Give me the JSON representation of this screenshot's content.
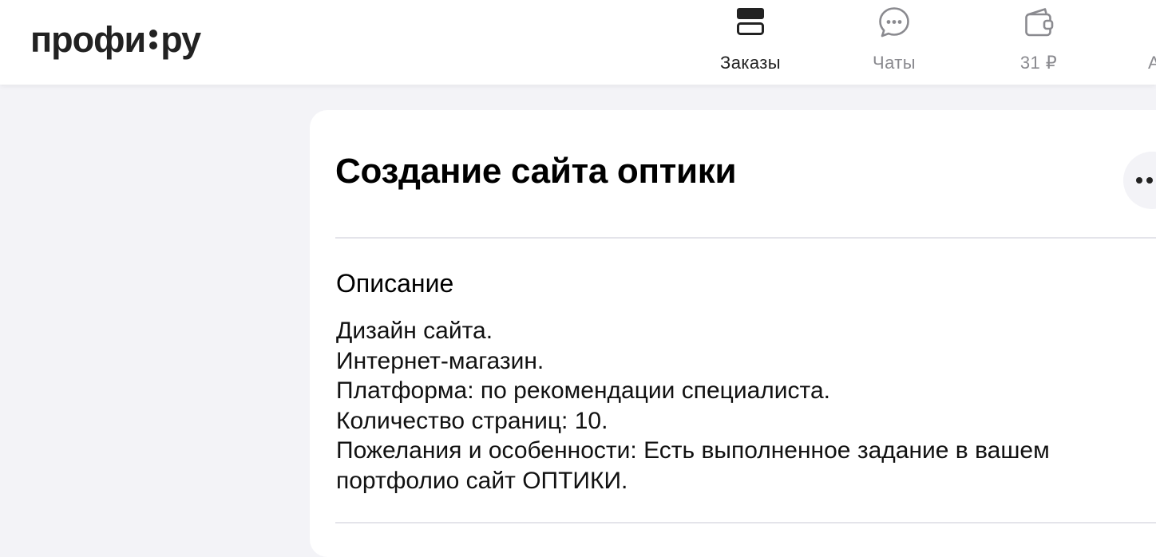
{
  "header": {
    "logo": {
      "left": "профи",
      "right": "ру"
    },
    "nav": [
      {
        "label": "Заказы",
        "icon": "orders-icon",
        "active": true
      },
      {
        "label": "Чаты",
        "icon": "chat-bubble-icon",
        "active": false
      },
      {
        "label": "31 ₽",
        "icon": "wallet-icon",
        "active": false
      }
    ],
    "nav_cut_label": "А"
  },
  "order": {
    "title": "Создание сайта оптики",
    "more_icon": "more-dots-icon",
    "description_heading": "Описание",
    "description_lines": [
      "Дизайн сайта.",
      "Интернет-магазин.",
      "Платформа: по рекомендации специалиста.",
      "Количество страниц: 10.",
      "Пожелания и особенности: Есть выполненное задание в вашем",
      "портфолио сайт ОПТИКИ."
    ]
  },
  "colors": {
    "page_background": "#f3f3f7",
    "card_background": "#ffffff",
    "text_primary": "#000000",
    "nav_inactive": "#8a8a8f",
    "divider": "#e4e4ea"
  }
}
